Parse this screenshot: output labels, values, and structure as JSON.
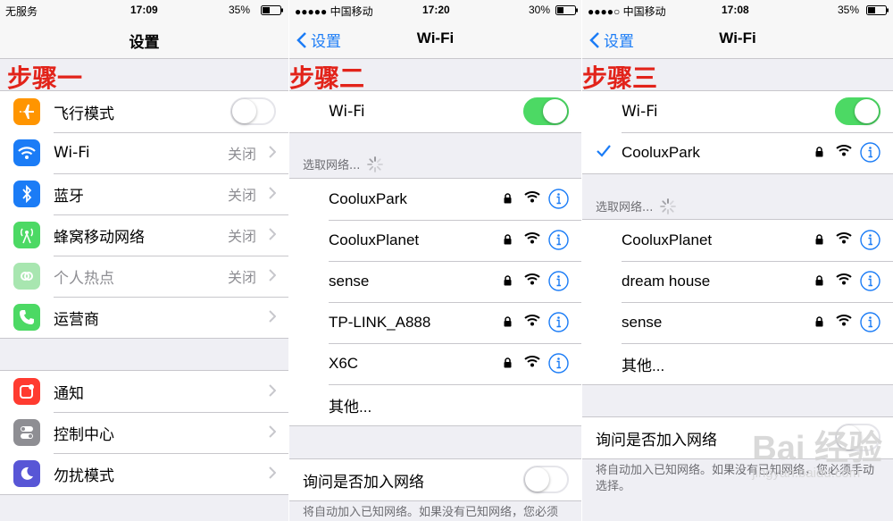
{
  "phones": [
    {
      "status": {
        "left": "无服务",
        "time": "17:09",
        "battery": "35%"
      },
      "nav": {
        "title": "设置"
      },
      "step_label": "步骤一",
      "group1": [
        {
          "label": "飞行模式",
          "icon": "airplane-icon",
          "color": "#ff9500",
          "control": "toggle-off"
        },
        {
          "label": "Wi-Fi",
          "icon": "wifi-icon",
          "color": "#1b7cf6",
          "value": "关闭"
        },
        {
          "label": "蓝牙",
          "icon": "bluetooth-icon",
          "color": "#1b7cf6",
          "value": "关闭"
        },
        {
          "label": "蜂窝移动网络",
          "icon": "cellular-icon",
          "color": "#4cd964",
          "value": "关闭"
        },
        {
          "label": "个人热点",
          "icon": "hotspot-icon",
          "color": "#a8e6b0",
          "value": "关闭",
          "disabled": true
        },
        {
          "label": "运营商",
          "icon": "phone-icon",
          "color": "#4cd964"
        }
      ],
      "group2": [
        {
          "label": "通知",
          "icon": "notifications-icon",
          "color": "#ff3b30"
        },
        {
          "label": "控制中心",
          "icon": "control-center-icon",
          "color": "#8e8e93"
        },
        {
          "label": "勿扰模式",
          "icon": "moon-icon",
          "color": "#5856d6"
        }
      ]
    },
    {
      "status": {
        "left": "●●●●● 中国移动",
        "time": "17:20",
        "battery": "30%"
      },
      "nav": {
        "back": "设置",
        "title": "Wi-Fi"
      },
      "step_label": "步骤二",
      "wifi_row": {
        "label": "Wi-Fi",
        "state": "on"
      },
      "choose_header": "选取网络...",
      "networks": [
        "CooluxPark",
        "CooluxPlanet",
        "sense",
        "TP-LINK_A888",
        "X6C"
      ],
      "other": "其他...",
      "ask_join": {
        "label": "询问是否加入网络",
        "state": "off"
      },
      "footer": "将自动加入已知网络。如果没有已知网络，您必须"
    },
    {
      "status": {
        "left": "●●●●○ 中国移动",
        "time": "17:08",
        "battery": "35%"
      },
      "nav": {
        "back": "设置",
        "title": "Wi-Fi"
      },
      "step_label": "步骤三",
      "wifi_row": {
        "label": "Wi-Fi",
        "state": "on"
      },
      "connected": "CooluxPark",
      "choose_header": "选取网络...",
      "networks": [
        "CooluxPlanet",
        "dream house",
        "sense"
      ],
      "other": "其他...",
      "ask_join": {
        "label": "询问是否加入网络",
        "state": "off"
      },
      "footer": "将自动加入已知网络。如果没有已知网络，您必须手动选择。"
    }
  ],
  "colors": {
    "accent": "#1b7cf6",
    "toggle_on": "#4cd964",
    "step_red": "#e2231a"
  },
  "watermark": {
    "text": "Bai 经验",
    "url": "jingyan.baidu.com"
  }
}
